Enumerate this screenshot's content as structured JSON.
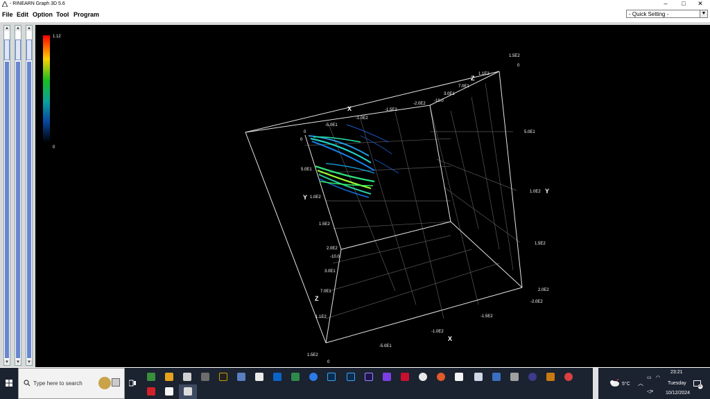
{
  "window": {
    "title": "- RINEARN Graph 3D 5.6",
    "minimize": "–",
    "maximize": "□",
    "close": "✕"
  },
  "menu": [
    "File",
    "Edit",
    "Option",
    "Tool",
    "Program"
  ],
  "quick_setting": {
    "value": "- Quick Setting -"
  },
  "colorbar": {
    "max_label": "1.12",
    "min_label": "0"
  },
  "axes": {
    "x_name": "X",
    "y_name": "Y",
    "z_name": "Z",
    "top_x_ticks": [
      "-5.0E1",
      "-1.0E2",
      "-1.5E2",
      "-2.0E2"
    ],
    "top_origin": "0",
    "top_origin_y": "0",
    "top_z_ticks": [
      "-10.0",
      "3.0E1",
      "7.0E1",
      "1.1E2"
    ],
    "corner_top_right_a": "1.5E2",
    "corner_top_right_b": "0",
    "left_y_ticks": [
      "5.0E1",
      "1.0E2",
      "1.5E2",
      "2.0E2"
    ],
    "left_z_ticks": [
      "-10.0",
      "3.0E1",
      "7.0E1",
      "1.1E2"
    ],
    "bottom_left_a": "1.5E2",
    "bottom_left_b": "0",
    "bottom_x_ticks": [
      "-5.0E1",
      "-1.0E2",
      "-1.5E2"
    ],
    "right_y_ticks": [
      "5.0E1",
      "1.0E2",
      "1.5E2",
      "2.0E2"
    ],
    "right_bottom_x": "-2.0E2"
  },
  "taskbar": {
    "search_placeholder": "Type here to search",
    "weather": "5°C",
    "time": "23:21",
    "day": "Tuesday",
    "date": "10/12/2024",
    "notifications": "20"
  }
}
